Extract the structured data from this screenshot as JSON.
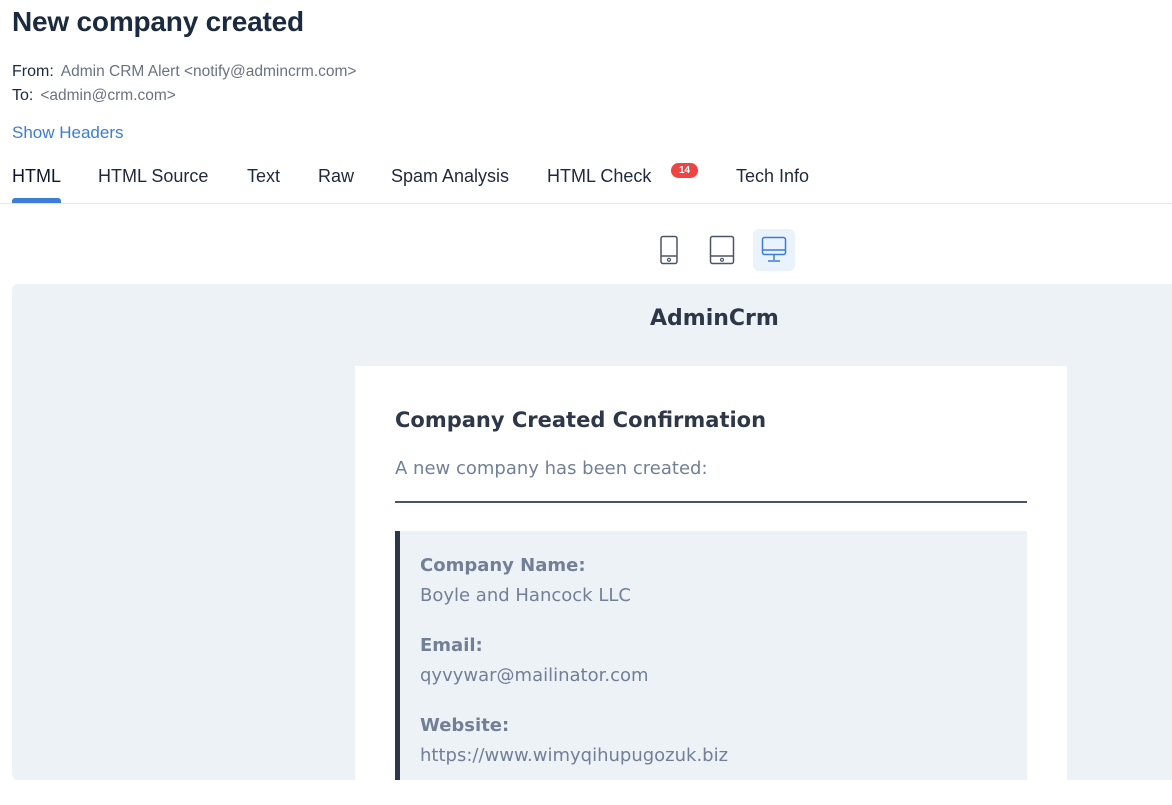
{
  "email": {
    "subject": "New company created",
    "from_label": "From:",
    "from_value": "Admin CRM Alert <notify@admincrm.com>",
    "to_label": "To:",
    "to_value": "<admin@crm.com>",
    "show_headers": "Show Headers"
  },
  "tabs": [
    {
      "label": "HTML",
      "active": true
    },
    {
      "label": "HTML Source"
    },
    {
      "label": "Text"
    },
    {
      "label": "Raw"
    },
    {
      "label": "Spam Analysis"
    },
    {
      "label": "HTML Check",
      "badge": "14"
    },
    {
      "label": "Tech Info"
    }
  ],
  "devices": [
    {
      "icon": "mobile-icon",
      "active": false
    },
    {
      "icon": "tablet-icon",
      "active": false
    },
    {
      "icon": "desktop-icon",
      "active": true
    }
  ],
  "preview": {
    "brand": "AdminCrm",
    "title": "Company Created Confirmation",
    "intro": "A new company has been created:",
    "fields": [
      {
        "label": "Company Name:",
        "value": "Boyle and Hancock LLC"
      },
      {
        "label": "Email:",
        "value": "qyvywar@mailinator.com"
      },
      {
        "label": "Website:",
        "value": "https://www.wimyqihupugozuk.biz"
      }
    ]
  },
  "colors": {
    "accent": "#3b7dd8",
    "badge": "#ef4444",
    "preview_bg": "#edf2f7",
    "panel_border": "#2d3748"
  }
}
